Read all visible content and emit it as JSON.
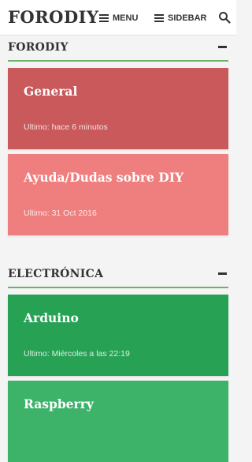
{
  "header": {
    "logo": "FORODIY",
    "menu_label": "MENU",
    "sidebar_label": "SIDEBAR"
  },
  "sections": [
    {
      "title": "FORODIY",
      "forums": [
        {
          "title": "General",
          "last": "Ultimo: hace 6 minutos",
          "color": "#c9595b"
        },
        {
          "title": "Ayuda/Dudas sobre DIY",
          "last": "Ultimo: 31 Oct 2016",
          "color": "#ef7f7f"
        }
      ]
    },
    {
      "title": "ELECTRÓNICA",
      "forums": [
        {
          "title": "Arduino",
          "last": "Ultimo: Miércoles a las 22:19",
          "color": "#27a255"
        },
        {
          "title": "Raspberry",
          "last": "",
          "color": "#3db36a"
        }
      ]
    }
  ]
}
